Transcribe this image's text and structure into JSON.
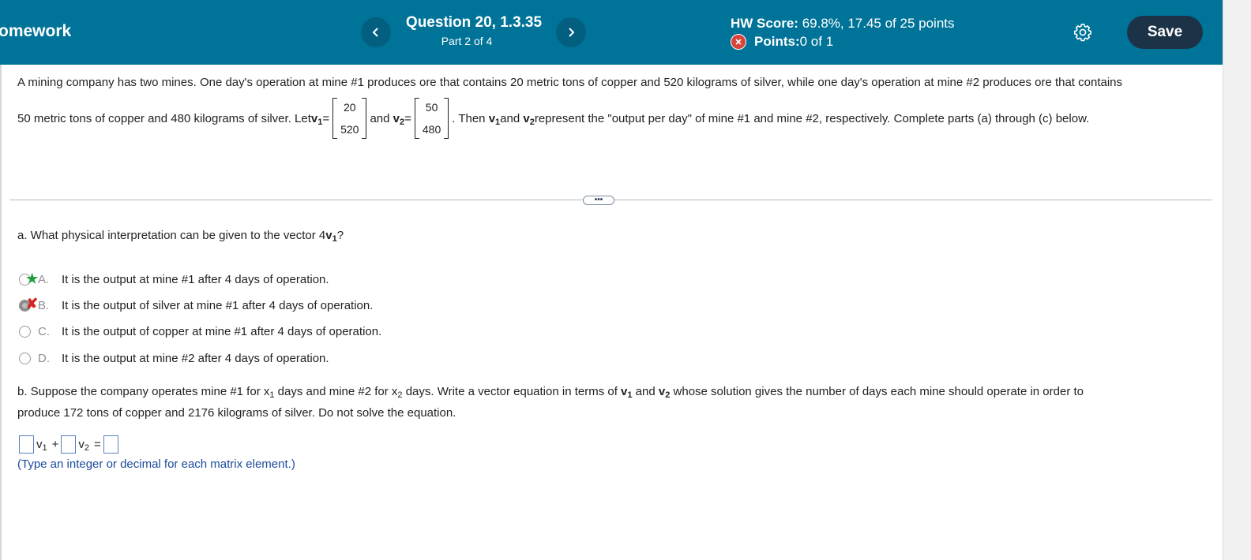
{
  "header": {
    "app_title": "omework",
    "question_title": "Question 20, 1.3.35",
    "question_part": "Part 2 of 4",
    "hw_score_label": "HW Score:",
    "hw_score_value": " 69.8%, 17.45 of 25 points",
    "points_label": "Points:",
    "points_value": " 0 of 1",
    "save_label": "Save",
    "prev_icon": "chevron-left-icon",
    "next_icon": "chevron-right-icon",
    "settings_icon": "gear-icon",
    "colors": {
      "header_bg": "#007399",
      "save_bg": "#1c3247",
      "nav_btn_bg": "#035f80"
    }
  },
  "problem": {
    "line1": "A mining company has two mines. One day's operation at mine #1 produces ore that contains 20 metric tons of copper and 520 kilograms of silver, while one day's operation at mine #2 produces ore that contains",
    "line2_start": "50 metric tons of copper and 480 kilograms of silver. Let ",
    "v": "v",
    "sub1": "1",
    "sub2": "2",
    "eq": " =",
    "and_text": "and ",
    "v1_values": [
      "20",
      "520"
    ],
    "v2_values": [
      "50",
      "480"
    ],
    "then_text": ". Then ",
    "and_mid": " and ",
    "line2_end": " represent the \"output per day\" of mine #1 and mine #2, respectively. Complete parts (a) through (c) below."
  },
  "expand_label": "•••",
  "part_a": {
    "question_prefix": "a. What physical interpretation can be given to the vector 4",
    "question_suffix": "?",
    "options": [
      {
        "letter": "A.",
        "text": "It is the output at mine #1 after 4 days of operation.",
        "selected": false,
        "mark": "★"
      },
      {
        "letter": "B.",
        "text": "It is the output of silver at mine #1 after 4 days of operation.",
        "selected": true,
        "mark": "✘"
      },
      {
        "letter": "C.",
        "text": "It is the output of copper at mine #1 after 4 days of operation.",
        "selected": false,
        "mark": ""
      },
      {
        "letter": "D.",
        "text": "It is the output at mine #2 after 4 days of operation.",
        "selected": false,
        "mark": ""
      }
    ]
  },
  "part_b": {
    "t1": "b. Suppose the company operates mine #1 for x",
    "t2": " days and mine #2 for x",
    "t3": " days. Write a vector equation in terms of ",
    "t4": " and ",
    "t5": " whose solution gives the number of days each mine should operate in order to",
    "line2": "produce 172 tons of copper and 2176 kilograms of silver. Do not solve the equation.",
    "plus": "+",
    "equals": "=",
    "hint": "(Type an integer or decimal for each matrix element.)"
  }
}
